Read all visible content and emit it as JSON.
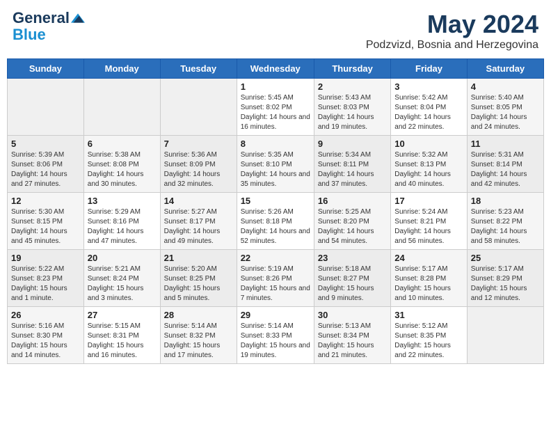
{
  "header": {
    "logo_line1": "General",
    "logo_line2": "Blue",
    "month_title": "May 2024",
    "subtitle": "Podzvizd, Bosnia and Herzegovina"
  },
  "days_of_week": [
    "Sunday",
    "Monday",
    "Tuesday",
    "Wednesday",
    "Thursday",
    "Friday",
    "Saturday"
  ],
  "weeks": [
    {
      "days": [
        {
          "number": "",
          "info": ""
        },
        {
          "number": "",
          "info": ""
        },
        {
          "number": "",
          "info": ""
        },
        {
          "number": "1",
          "info": "Sunrise: 5:45 AM\nSunset: 8:02 PM\nDaylight: 14 hours and 16 minutes."
        },
        {
          "number": "2",
          "info": "Sunrise: 5:43 AM\nSunset: 8:03 PM\nDaylight: 14 hours and 19 minutes."
        },
        {
          "number": "3",
          "info": "Sunrise: 5:42 AM\nSunset: 8:04 PM\nDaylight: 14 hours and 22 minutes."
        },
        {
          "number": "4",
          "info": "Sunrise: 5:40 AM\nSunset: 8:05 PM\nDaylight: 14 hours and 24 minutes."
        }
      ]
    },
    {
      "days": [
        {
          "number": "5",
          "info": "Sunrise: 5:39 AM\nSunset: 8:06 PM\nDaylight: 14 hours and 27 minutes."
        },
        {
          "number": "6",
          "info": "Sunrise: 5:38 AM\nSunset: 8:08 PM\nDaylight: 14 hours and 30 minutes."
        },
        {
          "number": "7",
          "info": "Sunrise: 5:36 AM\nSunset: 8:09 PM\nDaylight: 14 hours and 32 minutes."
        },
        {
          "number": "8",
          "info": "Sunrise: 5:35 AM\nSunset: 8:10 PM\nDaylight: 14 hours and 35 minutes."
        },
        {
          "number": "9",
          "info": "Sunrise: 5:34 AM\nSunset: 8:11 PM\nDaylight: 14 hours and 37 minutes."
        },
        {
          "number": "10",
          "info": "Sunrise: 5:32 AM\nSunset: 8:13 PM\nDaylight: 14 hours and 40 minutes."
        },
        {
          "number": "11",
          "info": "Sunrise: 5:31 AM\nSunset: 8:14 PM\nDaylight: 14 hours and 42 minutes."
        }
      ]
    },
    {
      "days": [
        {
          "number": "12",
          "info": "Sunrise: 5:30 AM\nSunset: 8:15 PM\nDaylight: 14 hours and 45 minutes."
        },
        {
          "number": "13",
          "info": "Sunrise: 5:29 AM\nSunset: 8:16 PM\nDaylight: 14 hours and 47 minutes."
        },
        {
          "number": "14",
          "info": "Sunrise: 5:27 AM\nSunset: 8:17 PM\nDaylight: 14 hours and 49 minutes."
        },
        {
          "number": "15",
          "info": "Sunrise: 5:26 AM\nSunset: 8:18 PM\nDaylight: 14 hours and 52 minutes."
        },
        {
          "number": "16",
          "info": "Sunrise: 5:25 AM\nSunset: 8:20 PM\nDaylight: 14 hours and 54 minutes."
        },
        {
          "number": "17",
          "info": "Sunrise: 5:24 AM\nSunset: 8:21 PM\nDaylight: 14 hours and 56 minutes."
        },
        {
          "number": "18",
          "info": "Sunrise: 5:23 AM\nSunset: 8:22 PM\nDaylight: 14 hours and 58 minutes."
        }
      ]
    },
    {
      "days": [
        {
          "number": "19",
          "info": "Sunrise: 5:22 AM\nSunset: 8:23 PM\nDaylight: 15 hours and 1 minute."
        },
        {
          "number": "20",
          "info": "Sunrise: 5:21 AM\nSunset: 8:24 PM\nDaylight: 15 hours and 3 minutes."
        },
        {
          "number": "21",
          "info": "Sunrise: 5:20 AM\nSunset: 8:25 PM\nDaylight: 15 hours and 5 minutes."
        },
        {
          "number": "22",
          "info": "Sunrise: 5:19 AM\nSunset: 8:26 PM\nDaylight: 15 hours and 7 minutes."
        },
        {
          "number": "23",
          "info": "Sunrise: 5:18 AM\nSunset: 8:27 PM\nDaylight: 15 hours and 9 minutes."
        },
        {
          "number": "24",
          "info": "Sunrise: 5:17 AM\nSunset: 8:28 PM\nDaylight: 15 hours and 10 minutes."
        },
        {
          "number": "25",
          "info": "Sunrise: 5:17 AM\nSunset: 8:29 PM\nDaylight: 15 hours and 12 minutes."
        }
      ]
    },
    {
      "days": [
        {
          "number": "26",
          "info": "Sunrise: 5:16 AM\nSunset: 8:30 PM\nDaylight: 15 hours and 14 minutes."
        },
        {
          "number": "27",
          "info": "Sunrise: 5:15 AM\nSunset: 8:31 PM\nDaylight: 15 hours and 16 minutes."
        },
        {
          "number": "28",
          "info": "Sunrise: 5:14 AM\nSunset: 8:32 PM\nDaylight: 15 hours and 17 minutes."
        },
        {
          "number": "29",
          "info": "Sunrise: 5:14 AM\nSunset: 8:33 PM\nDaylight: 15 hours and 19 minutes."
        },
        {
          "number": "30",
          "info": "Sunrise: 5:13 AM\nSunset: 8:34 PM\nDaylight: 15 hours and 21 minutes."
        },
        {
          "number": "31",
          "info": "Sunrise: 5:12 AM\nSunset: 8:35 PM\nDaylight: 15 hours and 22 minutes."
        },
        {
          "number": "",
          "info": ""
        }
      ]
    }
  ]
}
